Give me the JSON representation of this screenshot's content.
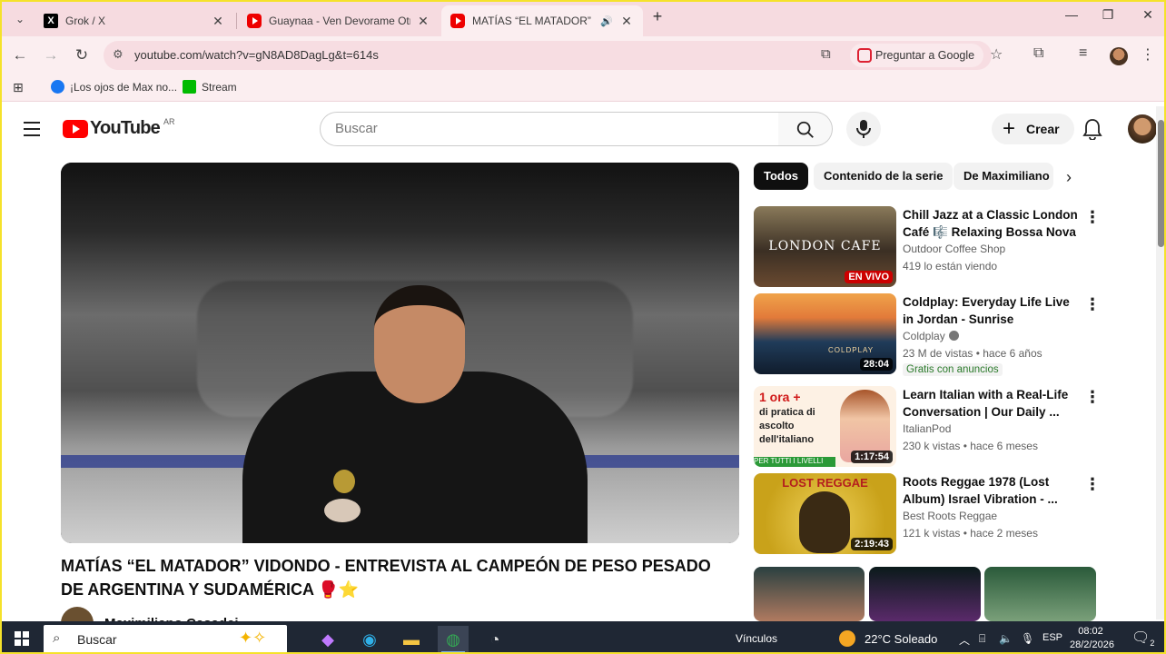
{
  "browser": {
    "tabs": [
      {
        "title": "Grok / X",
        "favicon": "x-icon"
      },
      {
        "title": "Guaynaa - Ven Devorame Otra",
        "favicon": "youtube-icon"
      },
      {
        "title": "MATÍAS “EL MATADOR” VID",
        "favicon": "youtube-icon",
        "active": true
      }
    ],
    "url": "youtube.com/watch?v=gN8AD8DagLg&t=614s",
    "ask_google": "Preguntar a Google",
    "bookmarks": [
      {
        "label": "¡Los ojos de Max no...",
        "icon": "facebook-icon"
      },
      {
        "label": "Stream",
        "icon": "kick-icon"
      }
    ]
  },
  "youtube": {
    "logo_text": "YouTube",
    "country": "AR",
    "search_placeholder": "Buscar",
    "create_label": "Crear",
    "video": {
      "title": "MATÍAS “EL MATADOR” VIDONDO - ENTREVISTA AL CAMPEÓN DE PESO PESADO DE ARGENTINA Y SUDAMÉRICA 🥊⭐",
      "channel": "Maximiliano Casadei"
    },
    "chips": [
      "Todos",
      "Contenido de la serie",
      "De Maximiliano"
    ],
    "recommendations": [
      {
        "title": "Chill Jazz at a Classic London Café 🎼 Relaxing Bossa Nova ...",
        "channel": "Outdoor Coffee Shop",
        "meta": "419 lo están viendo",
        "badge_live": "EN VIVO",
        "thumb_text": "LONDON CAFE"
      },
      {
        "title": "Coldplay: Everyday Life Live in Jordan - Sunrise Performance",
        "channel": "Coldplay",
        "meta": "23 M de vistas • hace 6 años",
        "duration": "28:04",
        "extra": "Gratis con anuncios",
        "thumb_text": "COLDPLAY"
      },
      {
        "title": "Learn Italian with a Real-Life Conversation | Our Daily ...",
        "channel": "ItalianPod",
        "meta": "230 k vistas • hace 6 meses",
        "duration": "1:17:54",
        "thumb_line1": "1 ora +",
        "thumb_line2": "di pratica di ascolto dell'italiano",
        "thumb_line3": "PER TUTTI I LIVELLI"
      },
      {
        "title": "Roots Reggae 1978 (Lost Album) Israel Vibration - ...",
        "channel": "Best Roots Reggae",
        "meta": "121 k vistas • hace 2 meses",
        "duration": "2:19:43",
        "thumb_text": "LOST REGGAE"
      }
    ]
  },
  "taskbar": {
    "search_placeholder": "Buscar",
    "links_label": "Vínculos",
    "weather": "22°C  Soleado",
    "language": "ESP",
    "time": "08:02",
    "date": "28/2/2026",
    "notifications": "2"
  }
}
